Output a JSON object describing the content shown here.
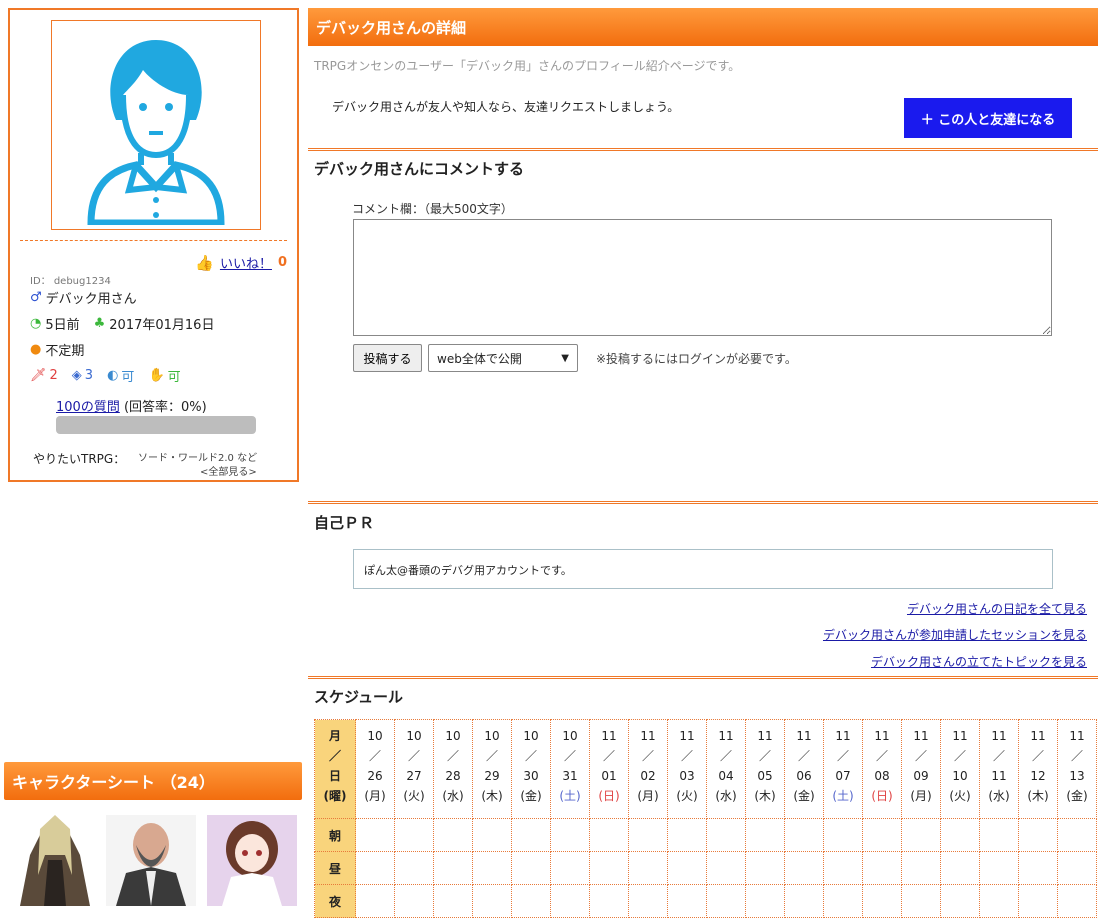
{
  "profile": {
    "like_label": "いいね！",
    "like_count": "0",
    "id_line": "ID： debug1234",
    "name": "デバック用さん",
    "last_login": "5日前",
    "registered": "2017年01月16日",
    "frequency": "不定期",
    "stats": {
      "swords": "2",
      "dice": "3",
      "voice": "可",
      "ok": "可"
    },
    "questions_link": "100の質問",
    "answer_rate": "(回答率：0%)",
    "answer_progress": 0,
    "trpg_label": "やりたいTRPG：",
    "trpg_value": "ソード・ワールド2.0 など",
    "trpg_more": "<全部見る>"
  },
  "char_sheet": {
    "title": "キャラクターシート （24）"
  },
  "main": {
    "title": "デバック用さんの詳細",
    "intro": "TRPGオンセンのユーザー「デバック用」さんのプロフィール紹介ページです。",
    "friend_text": "デバック用さんが友人や知人なら、友達リクエストしましょう。",
    "friend_button": "＋ この人と友達になる",
    "comment_title": "デバック用さんにコメントする",
    "comment_label": "コメント欄：（最大500文字）",
    "post_button": "投稿する",
    "scope_value": "web全体で公開",
    "post_note": "※投稿するにはログインが必要です。",
    "pr_title": "自己ＰＲ",
    "pr_text": "ぽん太@番頭のデバグ用アカウントです。",
    "links": [
      "デバック用さんの日記を全て見る",
      "デバック用さんが参加申請したセッションを見る",
      "デバック用さんの立てたトピックを見る"
    ],
    "schedule_title": "スケジュール"
  },
  "schedule": {
    "header_label": [
      "月",
      "／",
      "日",
      "(曜)"
    ],
    "slots": [
      "朝",
      "昼",
      "夜"
    ],
    "days": [
      {
        "m": "10",
        "d": "26",
        "w": "(月)",
        "t": ""
      },
      {
        "m": "10",
        "d": "27",
        "w": "(火)",
        "t": ""
      },
      {
        "m": "10",
        "d": "28",
        "w": "(水)",
        "t": ""
      },
      {
        "m": "10",
        "d": "29",
        "w": "(木)",
        "t": ""
      },
      {
        "m": "10",
        "d": "30",
        "w": "(金)",
        "t": ""
      },
      {
        "m": "10",
        "d": "31",
        "w": "(土)",
        "t": "sat"
      },
      {
        "m": "11",
        "d": "01",
        "w": "(日)",
        "t": "sun"
      },
      {
        "m": "11",
        "d": "02",
        "w": "(月)",
        "t": ""
      },
      {
        "m": "11",
        "d": "03",
        "w": "(火)",
        "t": ""
      },
      {
        "m": "11",
        "d": "04",
        "w": "(水)",
        "t": ""
      },
      {
        "m": "11",
        "d": "05",
        "w": "(木)",
        "t": ""
      },
      {
        "m": "11",
        "d": "06",
        "w": "(金)",
        "t": ""
      },
      {
        "m": "11",
        "d": "07",
        "w": "(土)",
        "t": "sat"
      },
      {
        "m": "11",
        "d": "08",
        "w": "(日)",
        "t": "sun"
      },
      {
        "m": "11",
        "d": "09",
        "w": "(月)",
        "t": ""
      },
      {
        "m": "11",
        "d": "10",
        "w": "(火)",
        "t": ""
      },
      {
        "m": "11",
        "d": "11",
        "w": "(水)",
        "t": ""
      },
      {
        "m": "11",
        "d": "12",
        "w": "(木)",
        "t": ""
      },
      {
        "m": "11",
        "d": "13",
        "w": "(金)",
        "t": ""
      }
    ]
  }
}
